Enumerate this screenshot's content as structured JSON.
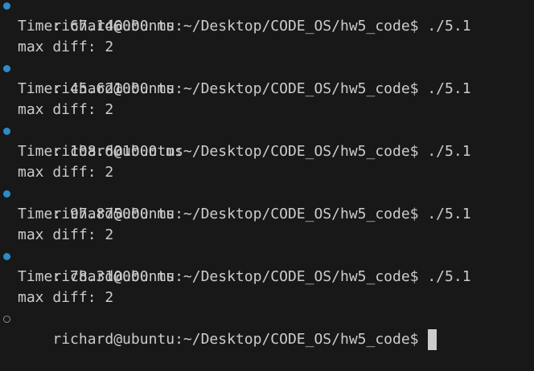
{
  "colors": {
    "background": "#181818",
    "text": "#cccccc",
    "success_marker": "#2c8cc8",
    "idle_marker": "#8a8a8a"
  },
  "terminal": {
    "runs": [
      {
        "prompt": "richard@ubuntu:~/Desktop/CODE_OS/hw5_code$ ./5.1",
        "time": "Time: 67.146000 ms",
        "diff": "max diff: 2"
      },
      {
        "prompt": "richard@ubuntu:~/Desktop/CODE_OS/hw5_code$ ./5.1",
        "time": "Time: 45.621000 ms",
        "diff": "max diff: 2"
      },
      {
        "prompt": "richard@ubuntu:~/Desktop/CODE_OS/hw5_code$ ./5.1",
        "time": "Time: 108.601000 ms",
        "diff": "max diff: 2"
      },
      {
        "prompt": "richard@ubuntu:~/Desktop/CODE_OS/hw5_code$ ./5.1",
        "time": "Time: 97.875000 ms",
        "diff": "max diff: 2"
      },
      {
        "prompt": "richard@ubuntu:~/Desktop/CODE_OS/hw5_code$ ./5.1",
        "time": "Time: 78.310000 ms",
        "diff": "max diff: 2"
      }
    ],
    "current_prompt": "richard@ubuntu:~/Desktop/CODE_OS/hw5_code$"
  }
}
